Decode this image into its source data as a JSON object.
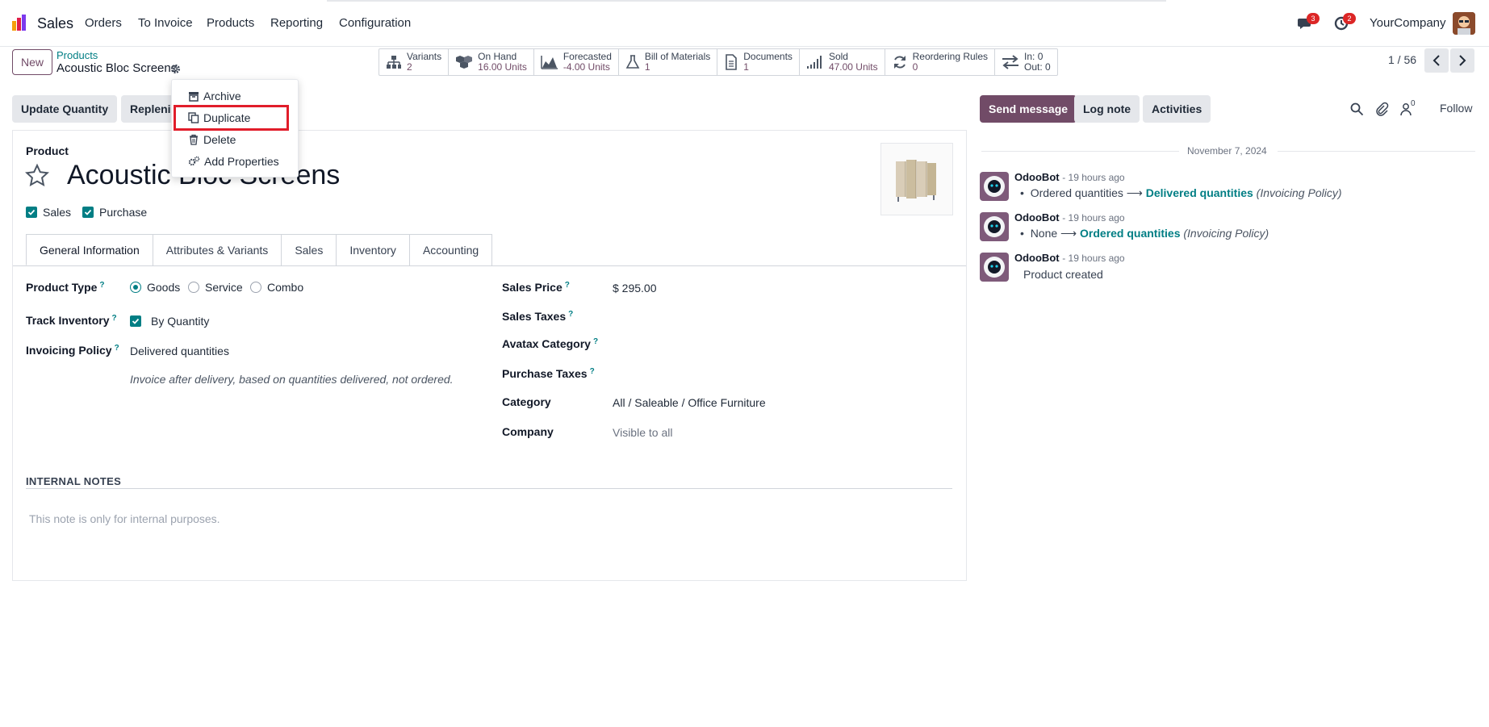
{
  "app": {
    "name": "Sales"
  },
  "menu": [
    "Orders",
    "To Invoice",
    "Products",
    "Reporting",
    "Configuration"
  ],
  "systray": {
    "messages_count": "3",
    "activities_count": "2",
    "company": "YourCompany"
  },
  "breadcrumb": {
    "parent": "Products",
    "current": "Acoustic Bloc Screens"
  },
  "new_button": "New",
  "smart_buttons": [
    {
      "title": "Variants",
      "value": "2",
      "icon": "sitemap-icon"
    },
    {
      "title": "On Hand",
      "value": "16.00 Units",
      "icon": "cubes-icon"
    },
    {
      "title": "Forecasted",
      "value": "-4.00 Units",
      "icon": "area-chart-icon"
    },
    {
      "title": "Bill of Materials",
      "value": "1",
      "icon": "flask-icon"
    },
    {
      "title": "Documents",
      "value": "1",
      "icon": "file-icon"
    },
    {
      "title": "Sold",
      "value": "47.00 Units",
      "icon": "signal-icon"
    },
    {
      "title": "Reordering Rules",
      "value": "0",
      "icon": "refresh-icon"
    },
    {
      "title": "In: 0",
      "value": "Out: 0",
      "icon": "exchange-icon"
    }
  ],
  "pager": {
    "text": "1 / 56"
  },
  "action_buttons": {
    "update_qty": "Update Quantity",
    "replenish": "Repleni"
  },
  "gear_menu": {
    "archive": "Archive",
    "duplicate": "Duplicate",
    "delete": "Delete",
    "add_properties": "Add Properties"
  },
  "form": {
    "product_label": "Product",
    "name": "Acoustic Bloc Screens",
    "can_be_sold": "Sales",
    "can_be_purchased": "Purchase",
    "tabs": [
      "General Information",
      "Attributes & Variants",
      "Sales",
      "Inventory",
      "Accounting"
    ],
    "product_type": {
      "label": "Product Type",
      "options": [
        "Goods",
        "Service",
        "Combo"
      ],
      "selected": "Goods"
    },
    "track_inventory": {
      "label": "Track Inventory",
      "value": "By Quantity"
    },
    "invoicing_policy": {
      "label": "Invoicing Policy",
      "value": "Delivered quantities",
      "hint": "Invoice after delivery, based on quantities delivered, not ordered."
    },
    "sales_price": {
      "label": "Sales Price",
      "value": "$ 295.00"
    },
    "sales_taxes": {
      "label": "Sales Taxes"
    },
    "avatax_category": {
      "label": "Avatax Category"
    },
    "purchase_taxes": {
      "label": "Purchase Taxes"
    },
    "category": {
      "label": "Category",
      "value": "All / Saleable / Office Furniture"
    },
    "company": {
      "label": "Company",
      "value": "Visible to all"
    },
    "internal_notes": {
      "title": "INTERNAL NOTES",
      "placeholder": "This note is only for internal purposes."
    }
  },
  "chatter": {
    "send_message": "Send message",
    "log_note": "Log note",
    "activities": "Activities",
    "follower_count": "0",
    "follow": "Follow",
    "date": "November 7, 2024",
    "messages": [
      {
        "author": "OdooBot",
        "ago": "- 19 hours ago",
        "old": "Ordered quantities",
        "new": "Delivered quantities",
        "field": "(Invoicing Policy)"
      },
      {
        "author": "OdooBot",
        "ago": "- 19 hours ago",
        "old": "None",
        "new": "Ordered quantities",
        "field": "(Invoicing Policy)"
      },
      {
        "author": "OdooBot",
        "ago": "- 19 hours ago",
        "text": "Product created"
      }
    ]
  },
  "colors": {
    "brand": "#714b67",
    "accent": "#017e84",
    "highlight": "#e11d2a"
  }
}
